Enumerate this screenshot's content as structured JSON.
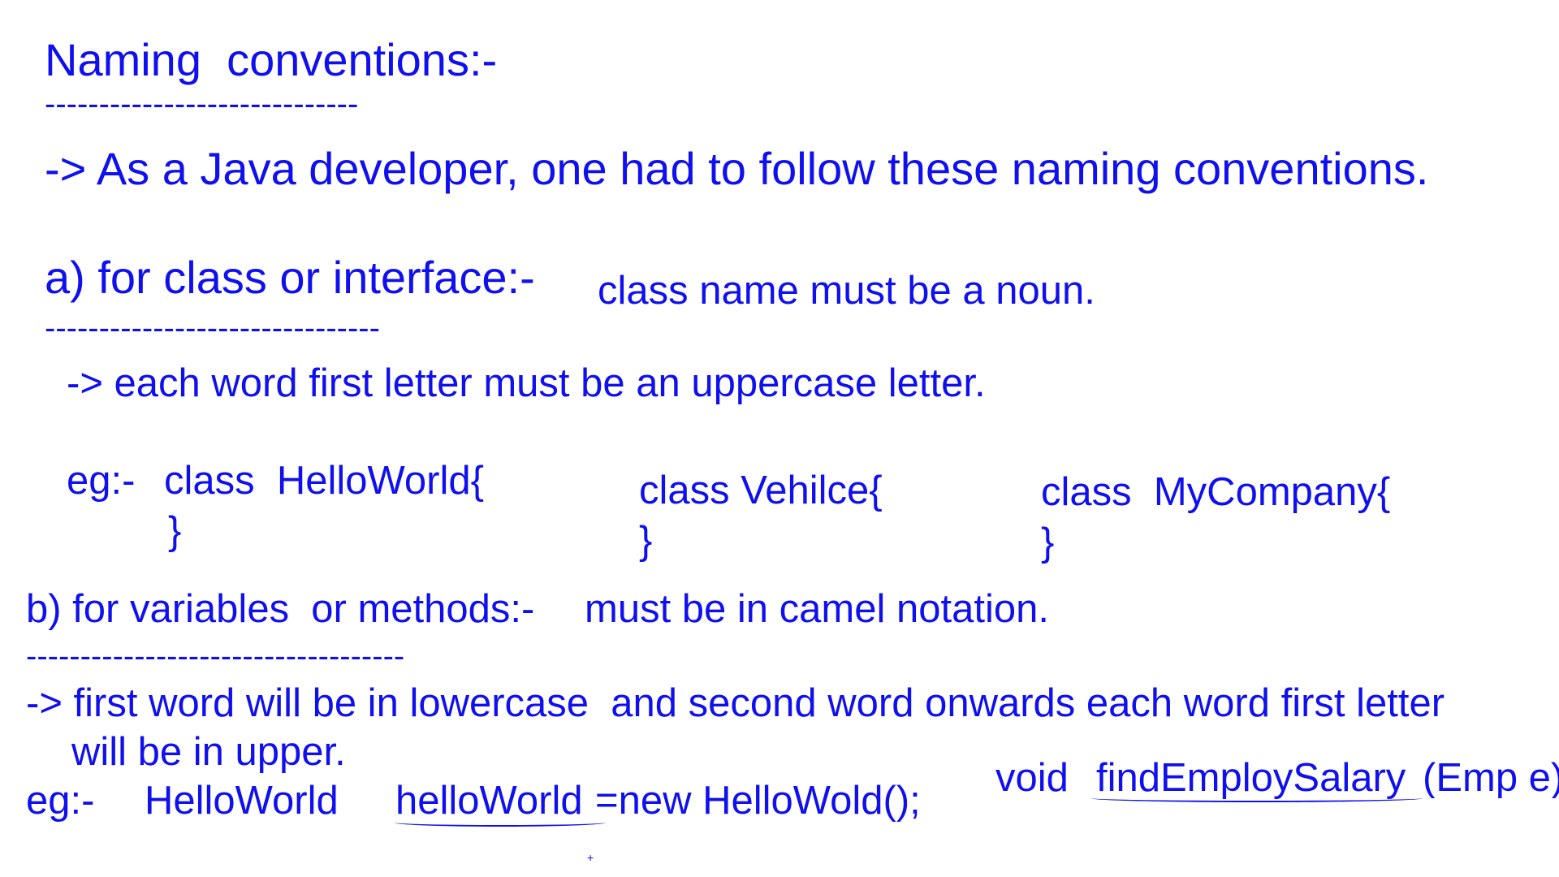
{
  "heading": {
    "title": "Naming  conventions:-",
    "rule": "-----------------------------"
  },
  "intro": "-> As a Java developer, one had to follow these naming conventions.",
  "section_a": {
    "title": "a) for class or interface:-",
    "note": "class name must be a noun.",
    "rule": "-------------------------------",
    "rule_text": "-> each word first letter must be an uppercase letter.",
    "eg_label": "eg:-",
    "examples": [
      {
        "open": "class  HelloWorld{",
        "close": "}"
      },
      {
        "open": "class Vehilce{",
        "close": "}"
      },
      {
        "open": "class  MyCompany{",
        "close": "}"
      }
    ]
  },
  "section_b": {
    "title": "b) for variables  or methods:-",
    "note": "must be in camel notation.",
    "rule": "-----------------------------------",
    "rule_text_1": "-> first word will be in lowercase  and second word onwards each word first letter",
    "rule_text_2": "will be in upper.",
    "eg_label": "eg:-",
    "example_type": "HelloWorld",
    "example_var": "helloWorld",
    "example_rest": "=new HelloWold();",
    "method_prefix": "void  ",
    "method_name": "findEmploySalary",
    "method_rest": "(Emp e)"
  },
  "marks": {
    "plus": "+"
  }
}
